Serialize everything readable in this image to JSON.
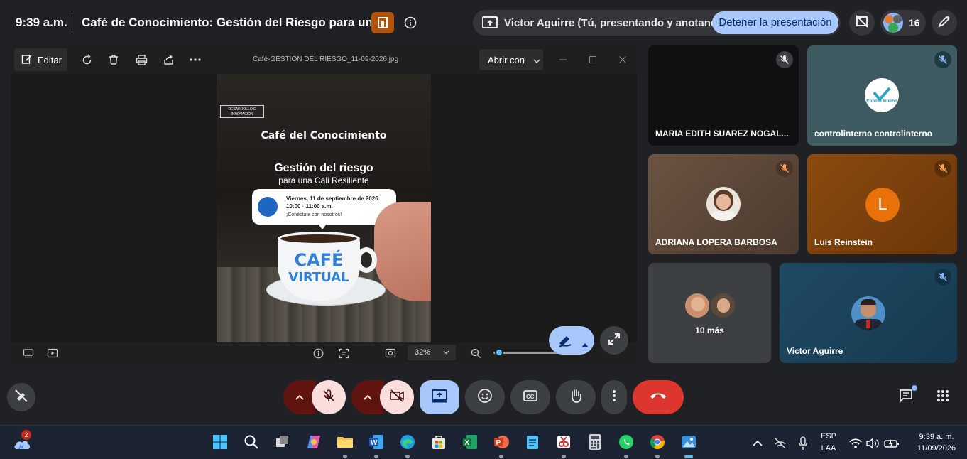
{
  "meeting": {
    "time": "9:39 a.m.",
    "title": "Café de Conocimiento: Gestión del Riesgo para una...",
    "presenting_text": "Victor Aguirre (Tú, presentando y anotando)",
    "stop_presenting_label": "Detener la presentación",
    "participant_count": "16"
  },
  "viewer": {
    "edit_label": "Editar",
    "file_name": "Café-GESTIÓN DEL RIESGO_11-09-2026.jpg",
    "open_with_label": "Abrir con",
    "zoom_level": "32%",
    "zoom_fraction": 0.02
  },
  "poster": {
    "tag": "DESARROLLO E INNOVACIÓN",
    "title": "Café del Conocimiento",
    "subtitle": "Gestión del riesgo",
    "subtitle2": "para una Cali Resiliente",
    "date_line": "Viernes, 11 de septiembre de 2026",
    "time_line": "10:00 - 11:00 a.m.",
    "cta": "¡Conéctate con nosotros!",
    "cup_word1": "CAFÉ",
    "cup_word2": "VIRTUAL"
  },
  "participants": [
    {
      "name": "MARIA EDITH SUAREZ NOGAL...",
      "muted": true
    },
    {
      "name": "controlinterno controlinterno",
      "muted": true,
      "logo_text": "Control Interno"
    },
    {
      "name": "ADRIANA LOPERA BARBOSA",
      "muted": true
    },
    {
      "name": "Luis Reinstein",
      "muted": true,
      "initial": "L"
    },
    {
      "name": "10 más"
    },
    {
      "name": "Victor Aguirre",
      "muted": true
    }
  ],
  "taskbar": {
    "weather_badge": "2",
    "lang_line1": "ESP",
    "lang_line2": "LAA",
    "clock_time": "9:39 a. m.",
    "clock_date": "11/09/2026"
  },
  "colors": {
    "accent_blue": "#a8c7fa",
    "hangup_red": "#dc362e",
    "muted_dark_red": "#601410",
    "muted_light_red": "#f9dedc"
  }
}
